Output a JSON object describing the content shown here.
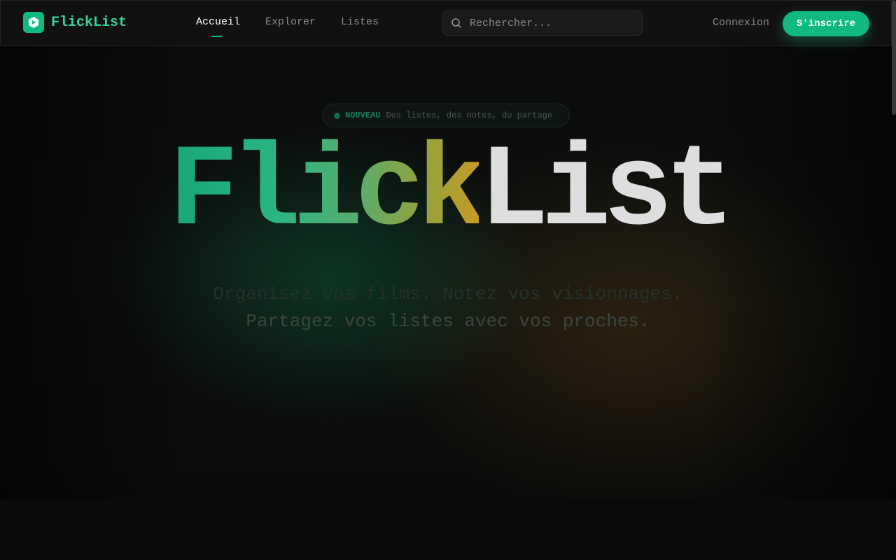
{
  "app": {
    "name": "FlickList",
    "brand_color": "#10b981",
    "logo_icon": "play-badge-icon"
  },
  "nav": {
    "items": [
      {
        "label": "Accueil",
        "active": true
      },
      {
        "label": "Explorer",
        "active": false
      },
      {
        "label": "Listes",
        "active": false
      }
    ]
  },
  "search": {
    "placeholder": "Rechercher...",
    "value": "",
    "icon": "search-icon"
  },
  "auth": {
    "login_label": "Connexion",
    "signup_label": "S'inscrire"
  },
  "hero": {
    "badge_tag": "NOUVEAU",
    "badge_text": "Des listes, des notes, du partage",
    "title_part1": "Flick",
    "title_part2": "List",
    "tagline_line1": "Organisez vos films. Notez vos visionnages.",
    "tagline_line2": "Partagez vos listes avec vos proches."
  }
}
